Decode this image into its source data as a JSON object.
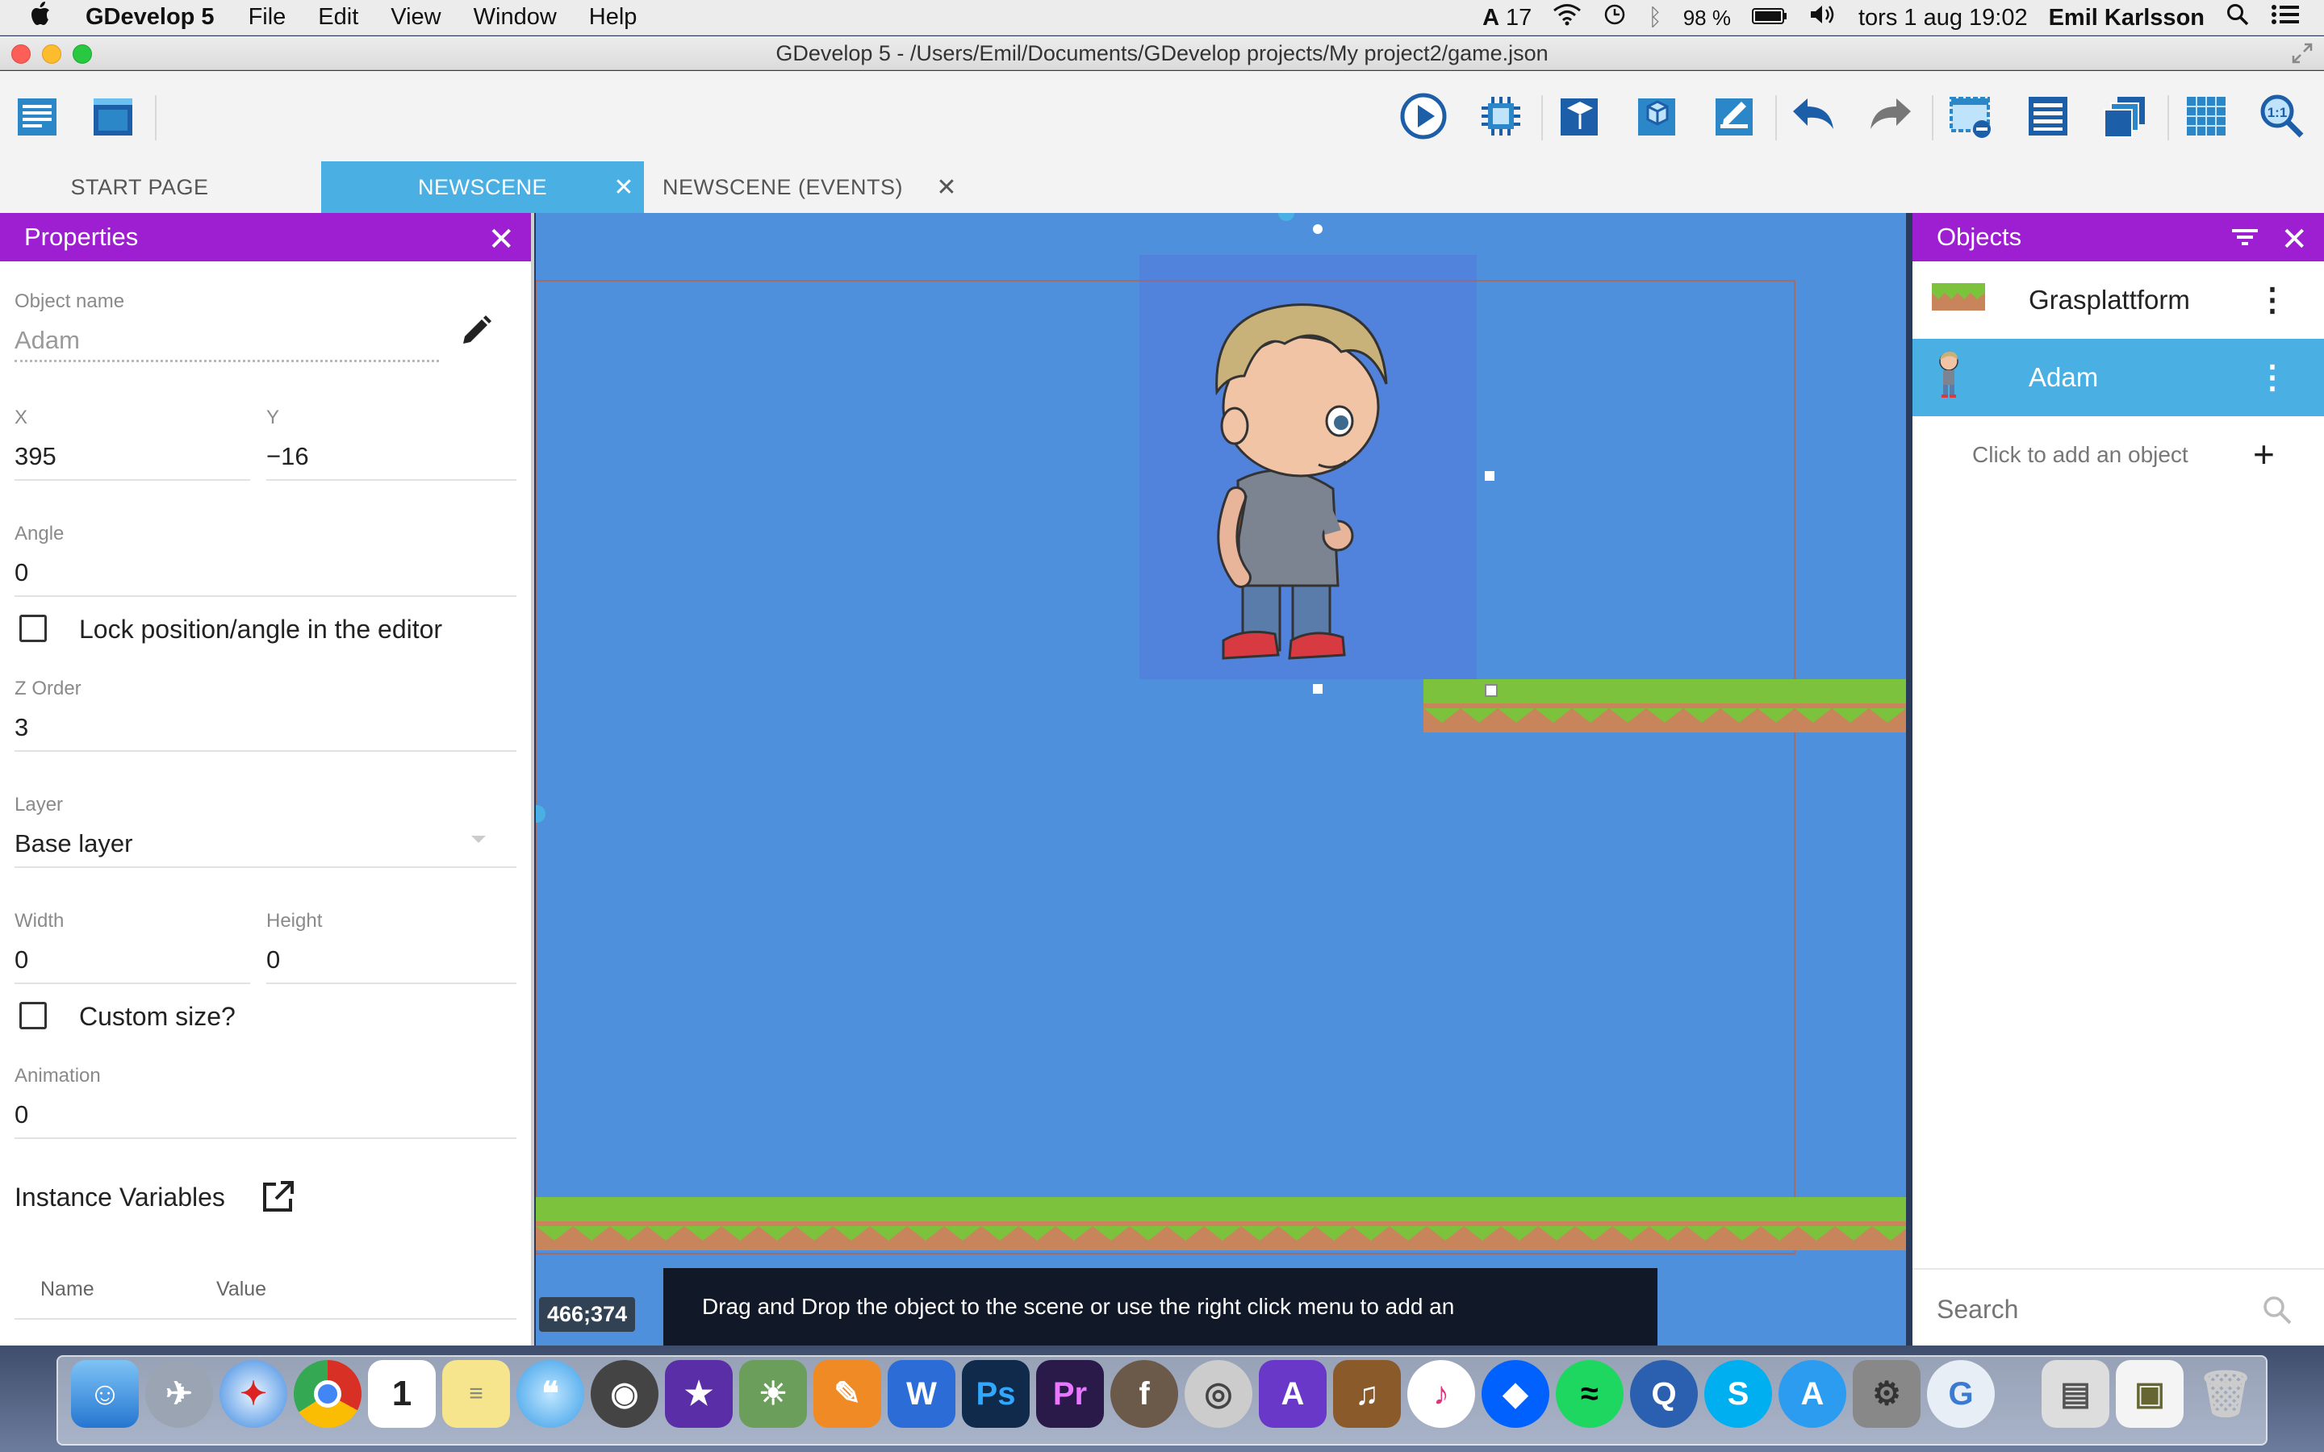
{
  "menubar": {
    "app_name": "GDevelop 5",
    "items": [
      "File",
      "Edit",
      "View",
      "Window",
      "Help"
    ],
    "adobe_count": "17",
    "battery": "98 %",
    "clock": "tors 1 aug  19:02",
    "user": "Emil Karlsson"
  },
  "window": {
    "title": "GDevelop 5 - /Users/Emil/Documents/GDevelop projects/My project2/game.json"
  },
  "tabs": [
    {
      "label": "START PAGE"
    },
    {
      "label": "NEWSCENE"
    },
    {
      "label": "NEWSCENE (EVENTS)"
    }
  ],
  "properties": {
    "header": "Properties",
    "object_name_label": "Object name",
    "object_name_value": "Adam",
    "x_label": "X",
    "x_value": "395",
    "y_label": "Y",
    "y_value": "−16",
    "angle_label": "Angle",
    "angle_value": "0",
    "lock_label": "Lock position/angle in the editor",
    "zorder_label": "Z Order",
    "zorder_value": "3",
    "layer_label": "Layer",
    "layer_value": "Base layer",
    "width_label": "Width",
    "width_value": "0",
    "height_label": "Height",
    "height_value": "0",
    "custom_size_label": "Custom size?",
    "animation_label": "Animation",
    "animation_value": "0",
    "instance_variables_label": "Instance Variables",
    "col_name": "Name",
    "col_value": "Value"
  },
  "scene": {
    "coordinates": "466;374",
    "hint": "Drag and Drop the object to the scene or use the right click menu to add an"
  },
  "objects": {
    "header": "Objects",
    "items": [
      {
        "name": "Grasplattform",
        "icon": "grass-platform-thumbnail"
      },
      {
        "name": "Adam",
        "icon": "character-thumbnail"
      }
    ],
    "add_label": "Click to add an object",
    "search_placeholder": "Search"
  },
  "colors": {
    "panel_header": "#9d1fd1",
    "tab_active": "#4ab0e4",
    "scene_bg": "#4f90dc",
    "grass": "#7cc23c",
    "dirt": "#c8845a"
  }
}
